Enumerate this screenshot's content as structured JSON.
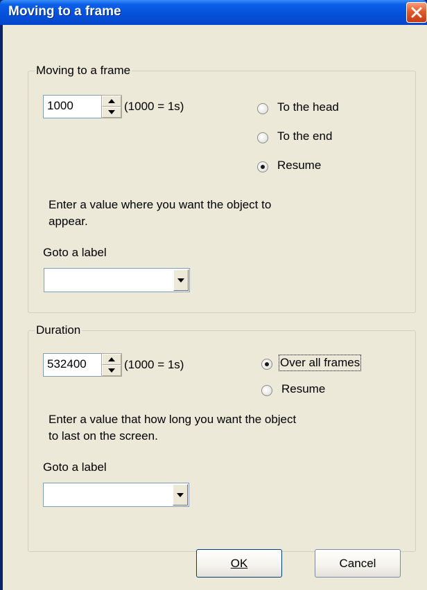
{
  "window": {
    "title": "Moving to a frame"
  },
  "frame_group": {
    "label": "Moving to a frame",
    "value": "1000",
    "unit_hint": "(1000 = 1s)",
    "radios": [
      {
        "label": "To the head",
        "checked": false
      },
      {
        "label": "To the end",
        "checked": false
      },
      {
        "label": "Resume",
        "checked": true
      }
    ],
    "description_line1": "Enter a value where you want the object to",
    "description_line2": "appear.",
    "goto_label": "Goto a label",
    "goto_value": ""
  },
  "duration_group": {
    "label": "Duration",
    "value": "532400",
    "unit_hint": "(1000 = 1s)",
    "radios": [
      {
        "label": "Over all frames",
        "checked": true
      },
      {
        "label": "Resume",
        "checked": false
      }
    ],
    "description_line1": "Enter a value that how long you want the object",
    "description_line2": "to last on the screen.",
    "goto_label": "Goto a label",
    "goto_value": ""
  },
  "buttons": {
    "ok": "OK",
    "cancel": "Cancel"
  }
}
